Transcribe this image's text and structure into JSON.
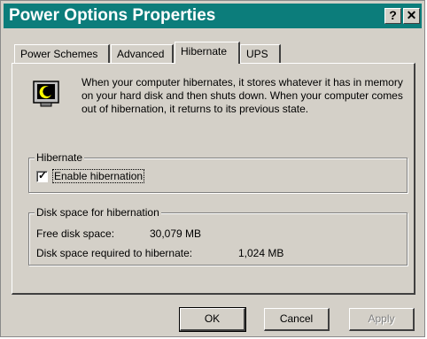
{
  "window": {
    "title": "Power Options Properties",
    "help_button": "?",
    "close_button": "✕"
  },
  "tabs": [
    {
      "label": "Power Schemes",
      "active": false
    },
    {
      "label": "Advanced",
      "active": false
    },
    {
      "label": "Hibernate",
      "active": true
    },
    {
      "label": "UPS",
      "active": false
    }
  ],
  "description": "When your computer hibernates, it stores whatever it has in memory on your hard disk and then shuts down. When your computer comes out of hibernation, it returns to its previous state.",
  "hibernate_group": {
    "legend": "Hibernate",
    "checkbox_label": "Enable hibernation",
    "checked": true
  },
  "disk_group": {
    "legend": "Disk space for hibernation",
    "free_label": "Free disk space:",
    "free_value": "30,079 MB",
    "required_label": "Disk space required to hibernate:",
    "required_value": "1,024 MB"
  },
  "buttons": {
    "ok": "OK",
    "cancel": "Cancel",
    "apply": "Apply"
  },
  "colors": {
    "titlebar": "#0c7d7b",
    "face": "#d4d0c8"
  },
  "icons": {
    "hibernate": "moon-monitor-icon"
  }
}
